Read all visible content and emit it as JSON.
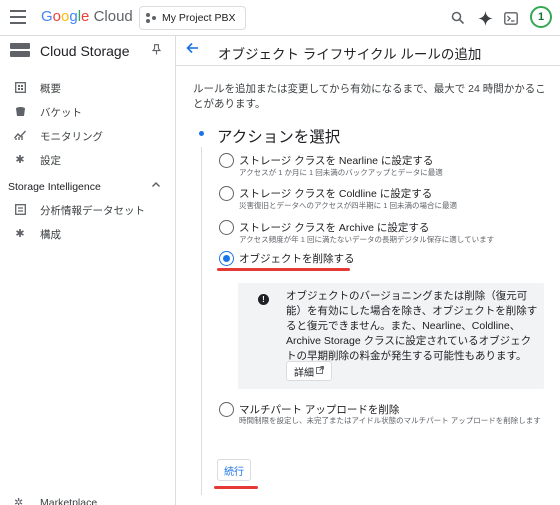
{
  "topbar": {
    "logo_google": "Google",
    "logo_cloud": "Cloud",
    "project_name": "My Project PBX",
    "avatar_text": "1"
  },
  "sidebar": {
    "product_title": "Cloud Storage",
    "items": [
      {
        "label": "概要",
        "icon": "overview-icon"
      },
      {
        "label": "バケット",
        "icon": "bucket-icon"
      },
      {
        "label": "モニタリング",
        "icon": "monitoring-icon"
      },
      {
        "label": "設定",
        "icon": "settings-gear-icon"
      }
    ],
    "section_title": "Storage Intelligence",
    "section_items": [
      {
        "label": "分析情報データセット",
        "icon": "dataset-icon"
      },
      {
        "label": "構成",
        "icon": "config-gear-icon"
      }
    ],
    "marketplace_label": "Marketplace"
  },
  "main": {
    "page_title": "オブジェクト ライフサイクル ルールの追加",
    "description": "ルールを追加または変更してから有効になるまで、最大で 24 時間かかることがあります。",
    "step_title": "アクションを選択",
    "options": [
      {
        "label": "ストレージ クラスを Nearline に設定する",
        "sub": "アクセスが 1 か月に 1 回未満のバックアップとデータに最適",
        "checked": false
      },
      {
        "label": "ストレージ クラスを Coldline に設定する",
        "sub": "災害復旧とデータへのアクセスが四半期に 1 回未満の場合に最適",
        "checked": false
      },
      {
        "label": "ストレージ クラスを Archive に設定する",
        "sub": "アクセス頻度が年 1 回に満たないデータの長期デジタル保存に適しています",
        "checked": false
      },
      {
        "label": "オブジェクトを削除する",
        "sub": "",
        "checked": true
      },
      {
        "label": "マルチパート アップロードを削除",
        "sub": "時間制限を設定し、未完了またはアイドル状態のマルチパート アップロードを削除します",
        "checked": false
      }
    ],
    "info_text": "オブジェクトのバージョニングまたは削除（復元可能）を有効にした場合を除き、オブジェクトを削除すると復元できません。また、Nearline、Coldline、Archive Storage クラスに設定されているオブジェクトの早期削除の料金が発生する可能性もあります。",
    "details_label": "詳細",
    "continue_label": "続行"
  },
  "colors": {
    "accent": "#1a73e8",
    "highlight_underline": "#e53935"
  }
}
